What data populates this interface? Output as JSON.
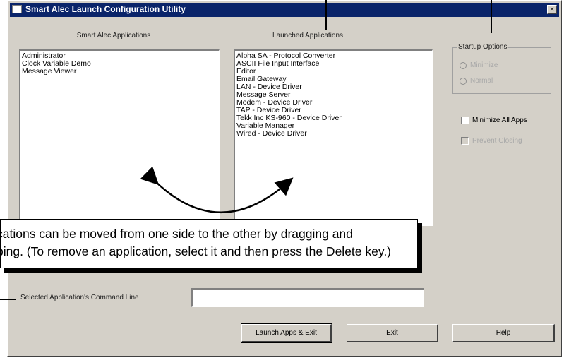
{
  "window": {
    "title": "Smart Alec Launch Configuration Utility",
    "close_glyph": "×"
  },
  "left_list": {
    "header": "Smart Alec Applications",
    "items": [
      "Administrator",
      "Clock Variable Demo",
      "Message Viewer"
    ]
  },
  "right_list": {
    "header": "Launched Applications",
    "items": [
      "Alpha SA - Protocol Converter",
      "ASCII File Input Interface",
      "Editor",
      "Email Gateway",
      "LAN - Device Driver",
      "Message Server",
      "Modem - Device Driver",
      "TAP - Device Driver",
      "Tekk Inc KS-960 - Device Driver",
      "Variable Manager",
      "Wired - Device Driver"
    ]
  },
  "startup_options": {
    "label": "Startup Options",
    "radio1": "Minimize",
    "radio2": "Normal"
  },
  "checkboxes": {
    "minimize_all": "Minimize All Apps",
    "prevent_closing": "Prevent Closing"
  },
  "command_line": {
    "label": "Selected Application's Command Line",
    "value": ""
  },
  "buttons": {
    "launch": "Launch Apps & Exit",
    "exit": "Exit",
    "help": "Help"
  },
  "annotation": {
    "line1": "cations can be moved from one side to the other by dragging and",
    "line2": "ping. (To remove an application, select it and then press the Delete key.)"
  },
  "colors": {
    "titlebar": "#0a246a",
    "dialog_bg": "#d4d0c8"
  }
}
